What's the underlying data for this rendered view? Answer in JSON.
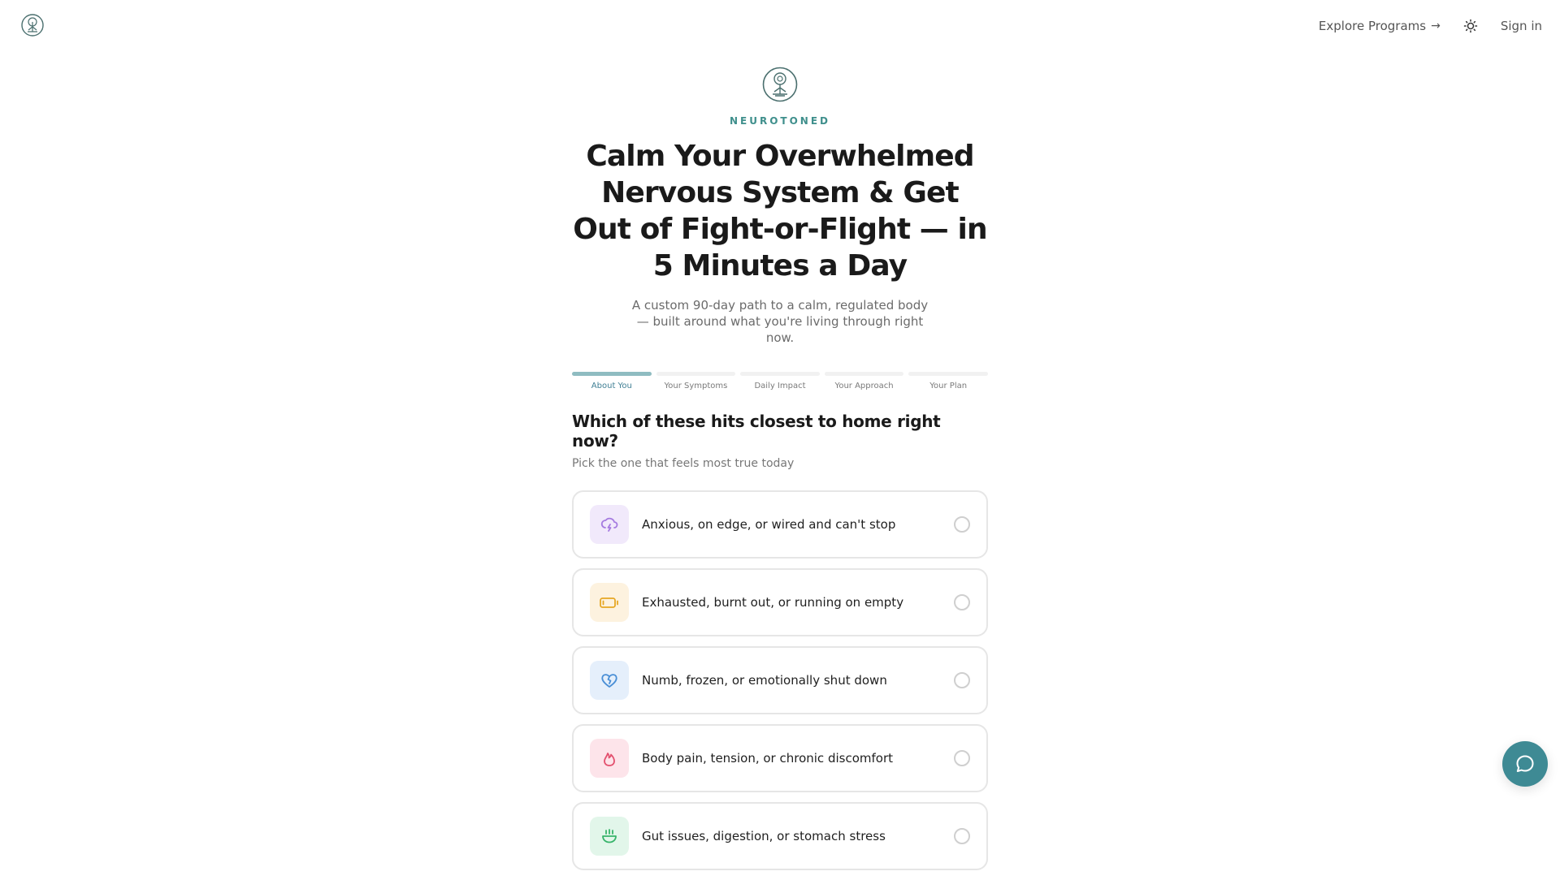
{
  "header": {
    "logo_icon": "tree-of-life-logo-icon",
    "explore_label": "Explore Programs",
    "explore_arrow": "→",
    "theme_icon": "sun-icon",
    "signin_label": "Sign in"
  },
  "hero": {
    "brand": "NEUROTONED",
    "headline": "Calm Your Overwhelmed Nervous System & Get Out of Fight-or-Flight — in 5 Minutes a Day",
    "subhead": "A custom 90-day path to a calm, regulated body — built around what you're living through right now."
  },
  "steps": [
    {
      "label": "About You",
      "active": true
    },
    {
      "label": "Your Symptoms",
      "active": false
    },
    {
      "label": "Daily Impact",
      "active": false
    },
    {
      "label": "Your Approach",
      "active": false
    },
    {
      "label": "Your Plan",
      "active": false
    }
  ],
  "quiz": {
    "question": "Which of these hits closest to home right now?",
    "subtitle": "Pick the one that feels most true today",
    "options": [
      {
        "label": "Anxious, on edge, or wired and can't stop",
        "icon": "storm-cloud-icon",
        "bg": "#f1e9fb",
        "color": "#a57be0"
      },
      {
        "label": "Exhausted, burnt out, or running on empty",
        "icon": "low-battery-icon",
        "bg": "#fdf2df",
        "color": "#e6a623"
      },
      {
        "label": "Numb, frozen, or emotionally shut down",
        "icon": "broken-heart-icon",
        "bg": "#e5effb",
        "color": "#4a8fd6"
      },
      {
        "label": "Body pain, tension, or chronic discomfort",
        "icon": "flame-icon",
        "bg": "#fde4ea",
        "color": "#e3506e"
      },
      {
        "label": "Gut issues, digestion, or stomach stress",
        "icon": "bowl-icon",
        "bg": "#e2f6ea",
        "color": "#37b46a"
      }
    ]
  },
  "chat": {
    "icon": "chat-bubble-icon",
    "color": "#3e8a94"
  },
  "colors": {
    "accent": "#3f8f8c",
    "progress_active": "#8fbcc1"
  }
}
